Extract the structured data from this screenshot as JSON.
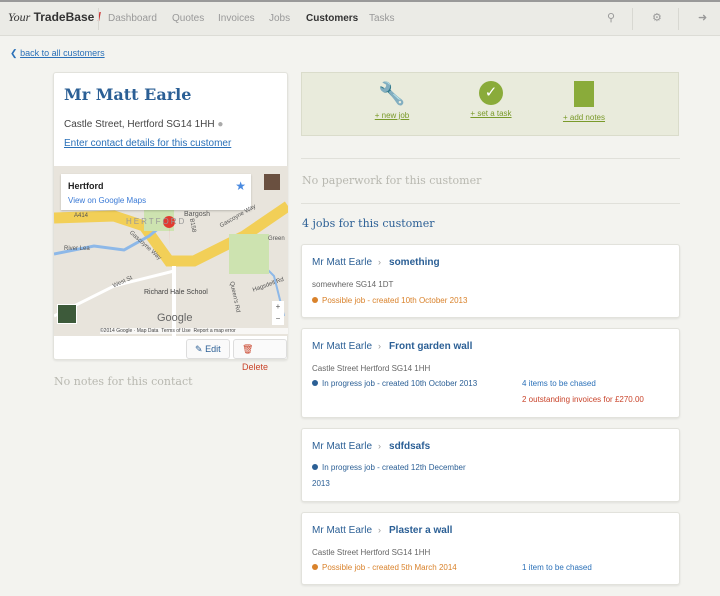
{
  "nav": {
    "logo": "Your TradeBase",
    "items": [
      "Dashboard",
      "Quotes",
      "Invoices",
      "Jobs",
      "Customers",
      "Tasks"
    ],
    "active": "Customers",
    "icons": [
      "search-icon",
      "gears-icon",
      "sign-out-icon"
    ]
  },
  "back_link": "back to all customers",
  "customer": {
    "name": "Mr Matt Earle",
    "address": "Castle Street, Hertford SG14 1HH",
    "contact_link": "Enter contact details for this customer",
    "map": {
      "place": "Hertford",
      "view_link": "View on Google Maps",
      "labels": [
        "A414",
        "HERTFORD",
        "Gascoyne Way",
        "Gascoyne Way",
        "B158",
        "Bargosh",
        "River Lea",
        "West St",
        "Richard Hale School",
        "Queen's Rd",
        "Hagsdell Rd",
        "Green"
      ],
      "logo": "Google",
      "footer": [
        "©2014 Google · Map Data",
        "Terms of Use",
        "Report a map error"
      ],
      "zoom": [
        "+",
        "−"
      ]
    },
    "edit": "Edit",
    "delete": "Delete",
    "no_notes": "No notes for this contact"
  },
  "actions": [
    {
      "label": "+ new job",
      "icon": "wrench-icon"
    },
    {
      "label": "+ set a task",
      "icon": "check-circle-icon"
    },
    {
      "label": "+ add notes",
      "icon": "notes-icon"
    }
  ],
  "no_paperwork": "No paperwork for this customer",
  "jobs_heading": "4 jobs for this customer",
  "jobs": [
    {
      "customer": "Mr Matt Earle",
      "title": "something",
      "address": "somewhere SG14 1DT",
      "status": "Possible job - created 10th October 2013",
      "status_color": "#d9822b",
      "right": []
    },
    {
      "customer": "Mr Matt Earle",
      "title": "Front garden wall",
      "address": "Castle Street Hertford SG14 1HH",
      "status": "In progress job - created 10th October 2013",
      "status_color": "#2b5f95",
      "right": [
        {
          "text": "4 items to be chased",
          "color": "#2a70b8"
        },
        {
          "text": "2 outstanding invoices for £270.00",
          "color": "#c9442b"
        }
      ]
    },
    {
      "customer": "Mr Matt Earle",
      "title": "sdfdsafs",
      "address": "",
      "status": "In progress job - created 12th December 2013",
      "status_color": "#2b5f95",
      "right": []
    },
    {
      "customer": "Mr Matt Earle",
      "title": "Plaster a wall",
      "address": "Castle Street Hertford SG14 1HH",
      "status": "Possible job - created 5th March 2014",
      "status_color": "#d9822b",
      "right": [
        {
          "text": "1 item to be chased",
          "color": "#2a70b8"
        }
      ]
    }
  ]
}
